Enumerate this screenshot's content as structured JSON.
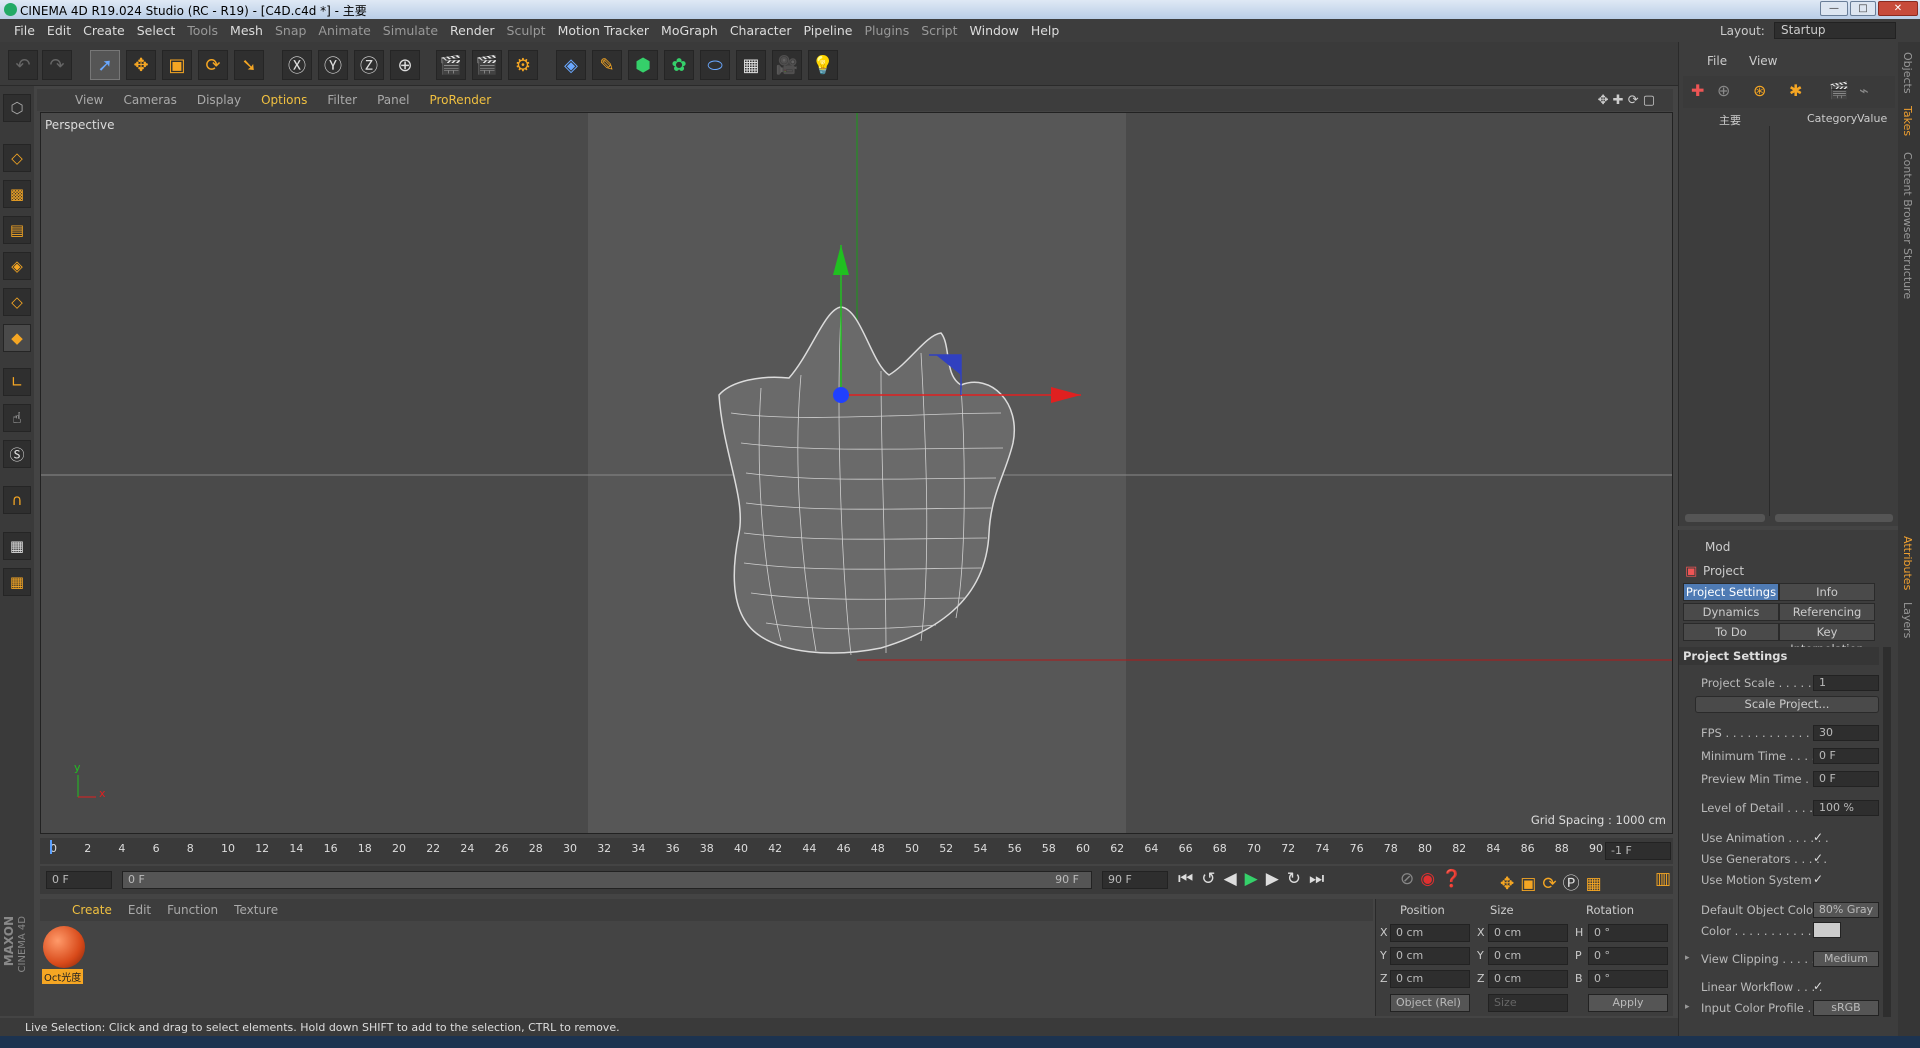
{
  "window": {
    "title": "CINEMA 4D R19.024 Studio (RC - R19) - [C4D.c4d *] - 主要",
    "btn_min": "—",
    "btn_max": "□",
    "btn_close": "✕"
  },
  "menu": [
    "File",
    "Edit",
    "Create",
    "Select",
    "Tools",
    "Mesh",
    "Snap",
    "Animate",
    "Simulate",
    "Render",
    "Sculpt",
    "Motion Tracker",
    "MoGraph",
    "Character",
    "Pipeline",
    "Plugins",
    "Script",
    "Window",
    "Help"
  ],
  "layout": {
    "label": "Layout:",
    "value": "Startup"
  },
  "viewport": {
    "menu": [
      "View",
      "Cameras",
      "Display",
      "Options",
      "Filter",
      "Panel",
      "ProRender"
    ],
    "camera_label": "Perspective",
    "grid_spacing": "Grid Spacing : 1000 cm",
    "axis_y": "y",
    "axis_x": "x"
  },
  "timeline": {
    "ticks": [
      "0",
      "2",
      "4",
      "6",
      "8",
      "10",
      "12",
      "14",
      "16",
      "18",
      "20",
      "22",
      "24",
      "26",
      "28",
      "30",
      "32",
      "34",
      "36",
      "38",
      "40",
      "42",
      "44",
      "46",
      "48",
      "50",
      "52",
      "54",
      "56",
      "58",
      "60",
      "62",
      "64",
      "66",
      "68",
      "70",
      "72",
      "74",
      "76",
      "78",
      "80",
      "82",
      "84",
      "86",
      "88",
      "90"
    ],
    "current_frame_right": "-1 F",
    "start_field": "0 F",
    "range_left": "0 F",
    "range_right": "90 F",
    "end_field": "90 F"
  },
  "materials": {
    "menu": [
      "Create",
      "Edit",
      "Function",
      "Texture"
    ],
    "item_label": "Oct光度"
  },
  "coords": {
    "headers": [
      "Position",
      "Size",
      "Rotation"
    ],
    "rows": [
      {
        "axis": "X",
        "pos": "0 cm",
        "saxis": "X",
        "size": "0 cm",
        "raxis": "H",
        "rot": "0 °"
      },
      {
        "axis": "Y",
        "pos": "0 cm",
        "saxis": "Y",
        "size": "0 cm",
        "raxis": "P",
        "rot": "0 °"
      },
      {
        "axis": "Z",
        "pos": "0 cm",
        "saxis": "Z",
        "size": "0 cm",
        "raxis": "B",
        "rot": "0 °"
      }
    ],
    "mode": "Object (Rel)",
    "size_mode": "Size",
    "apply": "Apply"
  },
  "objects": {
    "menu": [
      "File",
      "View"
    ],
    "col_name": "主要",
    "col_category": "Category",
    "col_value": "Value"
  },
  "attributes": {
    "mode": "Mod",
    "object": "Project",
    "tabs": [
      "Project Settings",
      "Info",
      "Dynamics",
      "Referencing",
      "To Do",
      "Key Interpolation"
    ],
    "section": "Project Settings",
    "rows": [
      {
        "label": "Project Scale . . . . . . .",
        "value": "1"
      },
      {
        "label": "FPS . . . . . . . . . . . . . . .",
        "value": "30"
      },
      {
        "label": "Minimum Time . . . . .",
        "value": "0 F"
      },
      {
        "label": "Preview Min Time . . .",
        "value": "0 F"
      },
      {
        "label": "Level of Detail . . . . . .",
        "value": "100 %"
      },
      {
        "label": "Use Animation . . . . . .",
        "value": "✓"
      },
      {
        "label": "Use Generators . . . . .",
        "value": "✓"
      },
      {
        "label": "Use Motion System",
        "value": "✓"
      },
      {
        "label": "Default Object Color",
        "value": "80% Gray"
      },
      {
        "label": "Color . . . . . . . . . . . . .",
        "value": ""
      },
      {
        "label": "View Clipping . . . . . .",
        "value": "Medium"
      },
      {
        "label": "Linear Workflow . . . .",
        "value": "✓"
      },
      {
        "label": "Input Color Profile . .",
        "value": "sRGB"
      }
    ],
    "scale_btn": "Scale Project..."
  },
  "right_tabs": [
    "Objects",
    "Takes",
    "Content Browser",
    "Structure",
    "Attributes",
    "Layers"
  ],
  "status": "Live Selection: Click and drag to select elements. Hold down SHIFT to add to the selection, CTRL to remove.",
  "maxon": {
    "line1": "MAXON",
    "line2": "CINEMA 4D"
  },
  "colors": {
    "accent_orange": "#f5a623",
    "selected_tab": "#4f7bb4",
    "menu_highlight": "#f0c040",
    "axis_x": "#e02020",
    "axis_y": "#20c020",
    "axis_z": "#3040e0"
  }
}
